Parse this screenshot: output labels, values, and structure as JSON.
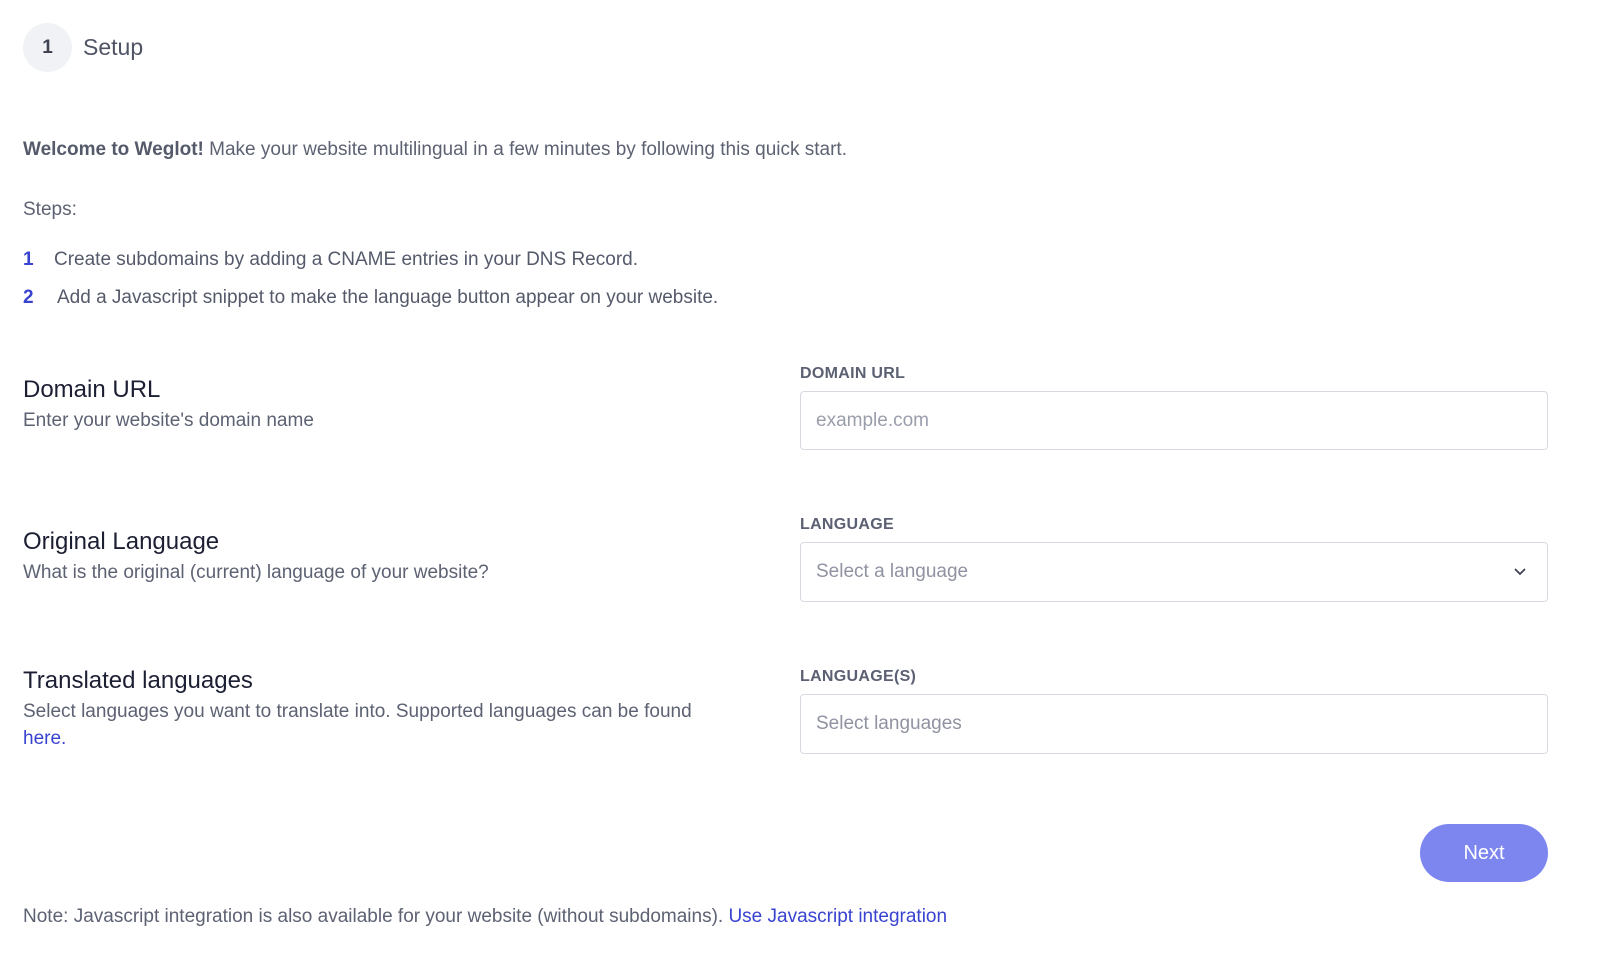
{
  "step": {
    "number": "1",
    "title": "Setup"
  },
  "intro": {
    "bold": "Welcome to Weglot!",
    "text": " Make your website multilingual in a few minutes by following this quick start."
  },
  "steps": {
    "label": "Steps:",
    "items": [
      {
        "num": "1",
        "text": "Create subdomains by adding a CNAME entries in your DNS Record."
      },
      {
        "num": "2",
        "text": "Add a Javascript snippet to make the language button appear on your website."
      }
    ]
  },
  "domain": {
    "title": "Domain URL",
    "desc": "Enter your website's domain name",
    "label": "DOMAIN URL",
    "placeholder": "example.com",
    "value": ""
  },
  "original_language": {
    "title": "Original Language",
    "desc": "What is the original (current) language of your website?",
    "label": "LANGUAGE",
    "placeholder": "Select a language"
  },
  "translated_languages": {
    "title": "Translated languages",
    "desc": "Select languages you want to translate into. Supported languages can be found ",
    "link": "here",
    "desc_end": ".",
    "label": "LANGUAGE(S)",
    "placeholder": "Select languages"
  },
  "next_label": "Next",
  "note": {
    "text": "Note: Javascript integration is also available for your website (without subdomains). ",
    "link": "Use Javascript integration"
  },
  "colors": {
    "accent": "#3843d0",
    "button": "#7d86ef"
  }
}
